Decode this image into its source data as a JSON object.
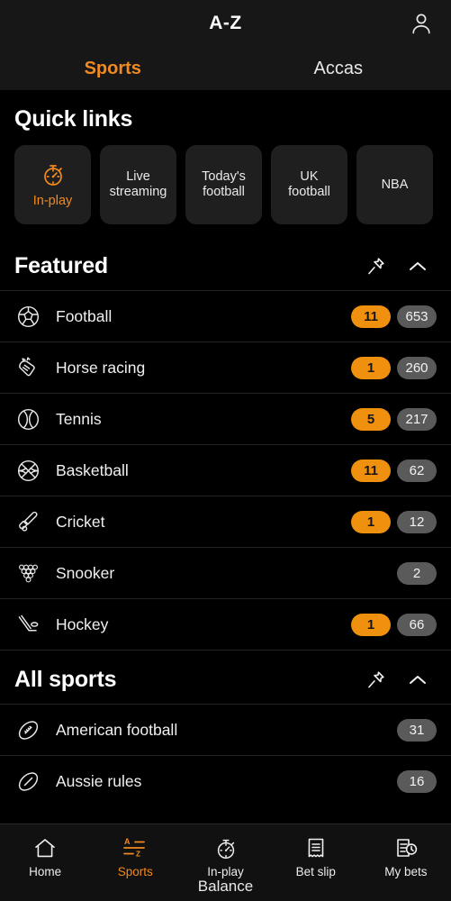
{
  "header": {
    "title": "A-Z",
    "account_icon": "person-icon",
    "tabs": [
      {
        "label": "Sports",
        "active": true
      },
      {
        "label": "Accas",
        "active": false
      }
    ]
  },
  "quick_links": {
    "title": "Quick links",
    "cards": [
      {
        "label": "In-play",
        "icon": "stopwatch-icon",
        "highlight": true
      },
      {
        "label": "Live\nstreaming",
        "icon": "",
        "highlight": false
      },
      {
        "label": "Today's\nfootball",
        "icon": "",
        "highlight": false
      },
      {
        "label": "UK\nfootball",
        "icon": "",
        "highlight": false
      },
      {
        "label": "NBA",
        "icon": "",
        "highlight": false
      }
    ]
  },
  "featured": {
    "title": "Featured",
    "pin_icon": "pin-icon",
    "collapse_icon": "chevron-up-icon",
    "rows": [
      {
        "name": "Football",
        "icon": "football-icon",
        "live": "11",
        "count": "653"
      },
      {
        "name": "Horse racing",
        "icon": "horse-racing-icon",
        "live": "1",
        "count": "260"
      },
      {
        "name": "Tennis",
        "icon": "tennis-icon",
        "live": "5",
        "count": "217"
      },
      {
        "name": "Basketball",
        "icon": "basketball-icon",
        "live": "11",
        "count": "62"
      },
      {
        "name": "Cricket",
        "icon": "cricket-icon",
        "live": "1",
        "count": "12"
      },
      {
        "name": "Snooker",
        "icon": "snooker-icon",
        "live": "",
        "count": "2"
      },
      {
        "name": "Hockey",
        "icon": "hockey-icon",
        "live": "1",
        "count": "66"
      }
    ]
  },
  "all_sports": {
    "title": "All sports",
    "pin_icon": "pin-icon",
    "collapse_icon": "chevron-up-icon",
    "rows": [
      {
        "name": "American football",
        "icon": "american-football-icon",
        "live": "",
        "count": "31"
      },
      {
        "name": "Aussie rules",
        "icon": "aussie-rules-icon",
        "live": "",
        "count": "16"
      }
    ]
  },
  "bottom_nav": {
    "balance_label": "Balance",
    "items": [
      {
        "label": "Home",
        "icon": "home-icon",
        "active": false
      },
      {
        "label": "Sports",
        "icon": "a-z-icon",
        "active": true
      },
      {
        "label": "In-play",
        "icon": "stopwatch-icon",
        "active": false
      },
      {
        "label": "Bet slip",
        "icon": "receipt-icon",
        "active": false
      },
      {
        "label": "My bets",
        "icon": "bets-clock-icon",
        "active": false
      }
    ]
  },
  "colors": {
    "accent": "#f08a21",
    "badge_live": "#f0900f",
    "badge_count": "#5a5a5a",
    "background": "#000000",
    "header_bg": "#171717",
    "card_bg": "#1f1f1f"
  }
}
